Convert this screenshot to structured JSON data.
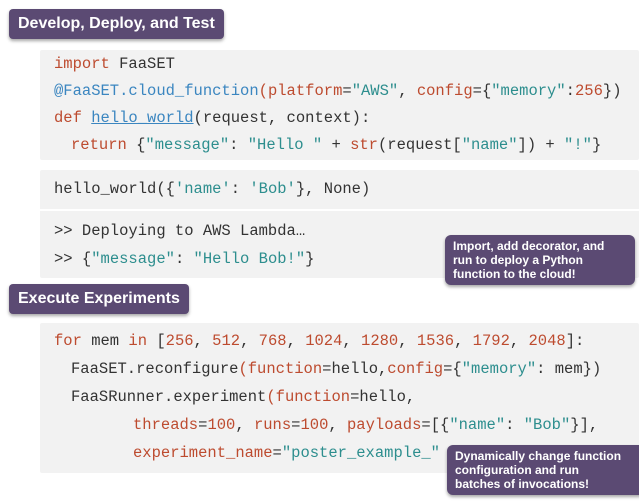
{
  "sections": {
    "develop": "Develop, Deploy, and Test",
    "execute": "Execute Experiments"
  },
  "code1": {
    "import_kw": "import",
    "import_mod": " FaaSET",
    "dec_name": "@FaaSET.cloud_function",
    "dec_open": "(",
    "param_platform": "platform",
    "eq1": "=",
    "val_aws": "\"AWS\"",
    "comma1": ", ",
    "param_config": "config",
    "eq2": "=",
    "dict_open": "{",
    "key_memory": "\"memory\"",
    "colon1": ":",
    "val_256": "256",
    "dict_close": "})",
    "def_kw": "def",
    "func_name": "hello_world",
    "def_args": "(request, context):",
    "return_kw": "return",
    "ret_open": " {",
    "key_message": "\"message\"",
    "ret_colon": ": ",
    "str_hello": "\"Hello \"",
    "ret_plus1": " + ",
    "str_fn": "str",
    "ret_req": "(request[",
    "key_name": "\"name\"",
    "ret_close_req": "]) + ",
    "str_bang": "\"!\"",
    "ret_close": "}"
  },
  "code2": {
    "call_prefix": "hello_world({",
    "key_name": "'name'",
    "colon": ": ",
    "val_bob": "'Bob'",
    "call_suffix": "}, None)",
    "out1": ">> Deploying to AWS Lambda…",
    "out2_prefix": ">> {",
    "out2_key": "\"message\"",
    "out2_colon": ": ",
    "out2_val": "\"Hello Bob!\"",
    "out2_suffix": "}"
  },
  "code3": {
    "for_kw": "for",
    "for_var": " mem ",
    "in_kw": "in",
    "list_open": " [",
    "values": [
      "256",
      "512",
      "768",
      "1024",
      "1280",
      "1536",
      "1792",
      "2048"
    ],
    "list_close": "]:",
    "reconf_prefix": "FaaSET.reconfigure",
    "reconf_open": "(",
    "p_function": "function",
    "reconf_eq": "=",
    "reconf_mid": "hello,",
    "p_config": "config",
    "reconf_eq2": "=",
    "reconf_dict_open": "{",
    "key_memory": "\"memory\"",
    "reconf_rest": ": mem})",
    "runner_prefix": "FaaSRunner.experiment",
    "runner_open": "(",
    "p_function2": "function",
    "runner_eq": "=",
    "runner_rest": "hello,",
    "p_threads": "threads",
    "threads_eq": "=",
    "threads_val": "100",
    "comma_a": ", ",
    "p_runs": "runs",
    "runs_eq": "=",
    "runs_val": "100",
    "comma_b": ", ",
    "p_payloads": "payloads",
    "payloads_eq": "=[{",
    "key_name": "\"name\"",
    "payload_colon": ": ",
    "val_bob": "\"Bob\"",
    "payload_close": "}],",
    "p_exp_name": "experiment_name",
    "exp_eq": "=",
    "val_exp": "\"poster_example_\"",
    "exp_plus": " + "
  },
  "callouts": {
    "deploy": [
      "Import, add decorator, and",
      "run to deploy a Python",
      "function to the cloud!"
    ],
    "dynamic": [
      "Dynamically change function",
      "configuration and run",
      "batches of invocations!"
    ]
  }
}
